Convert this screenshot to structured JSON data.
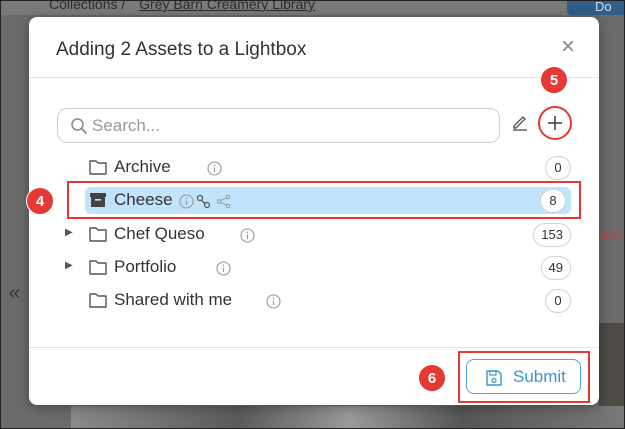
{
  "background": {
    "breadcrumb_root": "Collections",
    "breadcrumb_sep": "/",
    "breadcrumb_library": "Grey Barn Creamery Library",
    "right_button": "Do",
    "side_arrow": "«",
    "red_fragment": "ectio"
  },
  "dialog": {
    "title": "Adding 2 Assets to a Lightbox",
    "close_glyph": "×",
    "search": {
      "placeholder": "Search...",
      "value": ""
    },
    "submit_label": "Submit"
  },
  "folders": [
    {
      "name": "Archive",
      "count": "0",
      "expandable": false,
      "selected": false
    },
    {
      "name": "Cheese",
      "count": "8",
      "expandable": false,
      "selected": true
    },
    {
      "name": "Chef Queso",
      "count": "153",
      "expandable": true,
      "selected": false
    },
    {
      "name": "Portfolio",
      "count": "49",
      "expandable": true,
      "selected": false
    },
    {
      "name": "Shared with me",
      "count": "0",
      "expandable": false,
      "selected": false
    }
  ],
  "annotations": {
    "badge_4": "4",
    "badge_5": "5",
    "badge_6": "6"
  },
  "colors": {
    "accent": "#3b95cf",
    "selection": "#bfe4fb",
    "annotation_red": "#e53935"
  }
}
